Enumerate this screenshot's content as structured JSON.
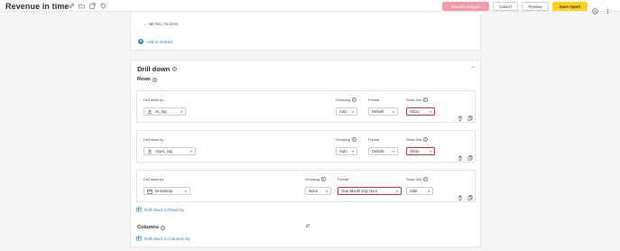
{
  "header": {
    "title": "Revenue in time",
    "buttons": {
      "discard": "Discard changes",
      "cancel": "Cancel",
      "preview": "Preview",
      "save": "Save report"
    }
  },
  "metrics_section": {
    "metric_filters_label": "METRIC FILTERS",
    "add_to_metrics_label": "Add to metrics"
  },
  "drill_down": {
    "title": "Drill down",
    "rows_title": "Rows",
    "columns_title": "Columns",
    "rows": [
      {
        "drill_label": "Drill down by",
        "field": "os_tag",
        "grouping_label": "Grouping",
        "grouping": "Auto",
        "format_label": "Format",
        "format": "Default",
        "show_na_label": "Show N/A",
        "show_na": "Show"
      },
      {
        "drill_label": "Drill down by",
        "field": "csync_tag",
        "grouping_label": "Grouping",
        "grouping": "Auto",
        "format_label": "Format",
        "format": "Default",
        "show_na_label": "Show N/A",
        "show_na": "Show"
      },
      {
        "drill_label": "Drill down by",
        "field": "timestamp",
        "grouping_label": "Grouping",
        "grouping": "None",
        "format_label": "Format",
        "format": "Year Month Day Hour",
        "show_na_label": "Show N/A",
        "show_na": "Hide"
      }
    ],
    "drill_rows_link": "Drill down in Rows by",
    "drill_columns_link": "Drill down in Columns by"
  },
  "colors": {
    "accent_link": "#2a7db8",
    "save_button": "#ffd21f",
    "discard_button": "#f29aa9",
    "highlight_border": "#d92a35"
  }
}
